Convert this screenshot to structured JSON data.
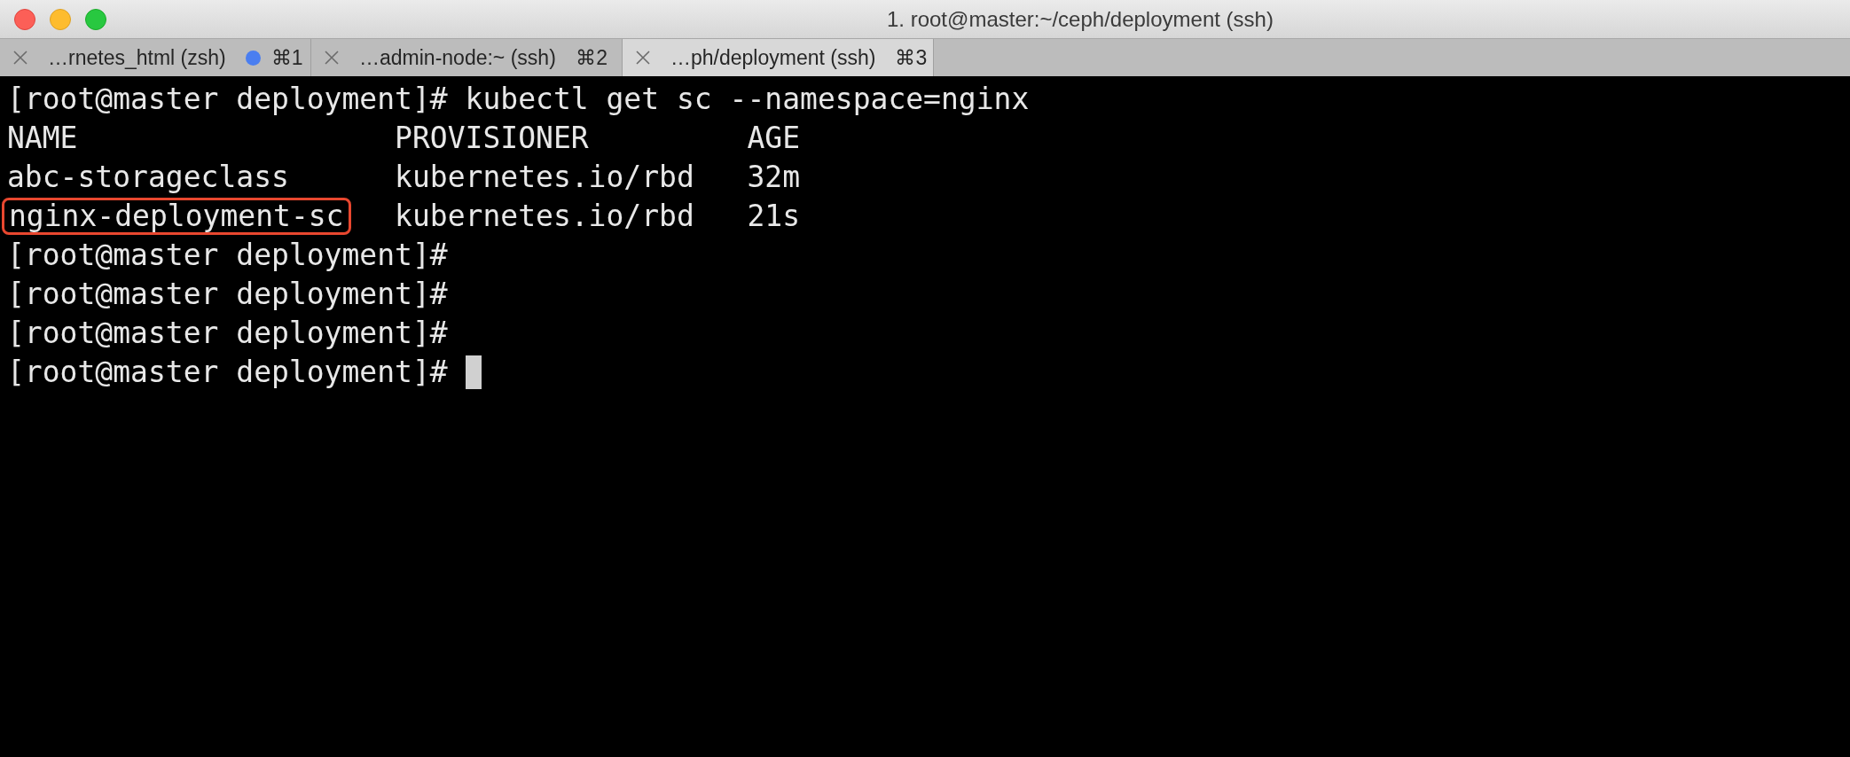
{
  "window": {
    "title": "1. root@master:~/ceph/deployment (ssh)"
  },
  "tabs": [
    {
      "label": "…rnetes_html (zsh)",
      "shortcut": "⌘1",
      "selected": false,
      "activity": true
    },
    {
      "label": "…admin-node:~ (ssh)",
      "shortcut": "⌘2",
      "selected": false,
      "activity": false
    },
    {
      "label": "…ph/deployment (ssh)",
      "shortcut": "⌘3",
      "selected": true,
      "activity": false
    }
  ],
  "terminal": {
    "command_line": {
      "prompt": "[root@master deployment]#",
      "command": "kubectl get sc --namespace=nginx"
    },
    "table": {
      "columns": [
        "NAME",
        "PROVISIONER",
        "AGE"
      ],
      "rows": [
        {
          "cells": [
            "abc-storageclass",
            "kubernetes.io/rbd",
            "32m"
          ],
          "highlighted": false
        },
        {
          "cells": [
            "nginx-deployment-sc",
            "kubernetes.io/rbd",
            "21s"
          ],
          "highlighted": true
        }
      ]
    },
    "prompts": [
      {
        "text": "[root@master deployment]#",
        "cursor": false
      },
      {
        "text": "[root@master deployment]#",
        "cursor": false
      },
      {
        "text": "[root@master deployment]#",
        "cursor": false
      },
      {
        "text": "[root@master deployment]#",
        "cursor": true
      }
    ]
  }
}
